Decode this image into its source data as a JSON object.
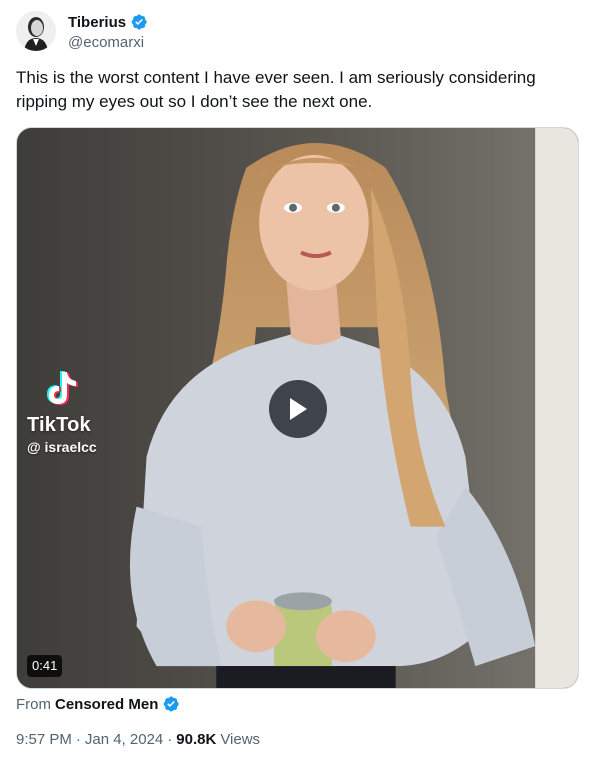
{
  "author": {
    "display_name": "Tiberius",
    "handle": "@ecomarxi",
    "verified": true
  },
  "tweet": {
    "text": "This is the worst content I have ever seen. I am seriously considering ripping my eyes out so I don’t see the next one."
  },
  "media": {
    "type": "video",
    "watermark_brand": "TikTok",
    "watermark_user": "@ israelcc",
    "duration": "0:41",
    "play_icon": "play-icon"
  },
  "attribution": {
    "prefix": "From",
    "source_name": "Censored Men",
    "verified": true
  },
  "meta": {
    "time": "9:57 PM",
    "separator": "·",
    "date": "Jan 4, 2024",
    "views_count": "90.8K",
    "views_label": "Views"
  },
  "colors": {
    "verified_blue": "#1d9bf0",
    "text_primary": "#0f1419",
    "text_secondary": "#536471"
  }
}
